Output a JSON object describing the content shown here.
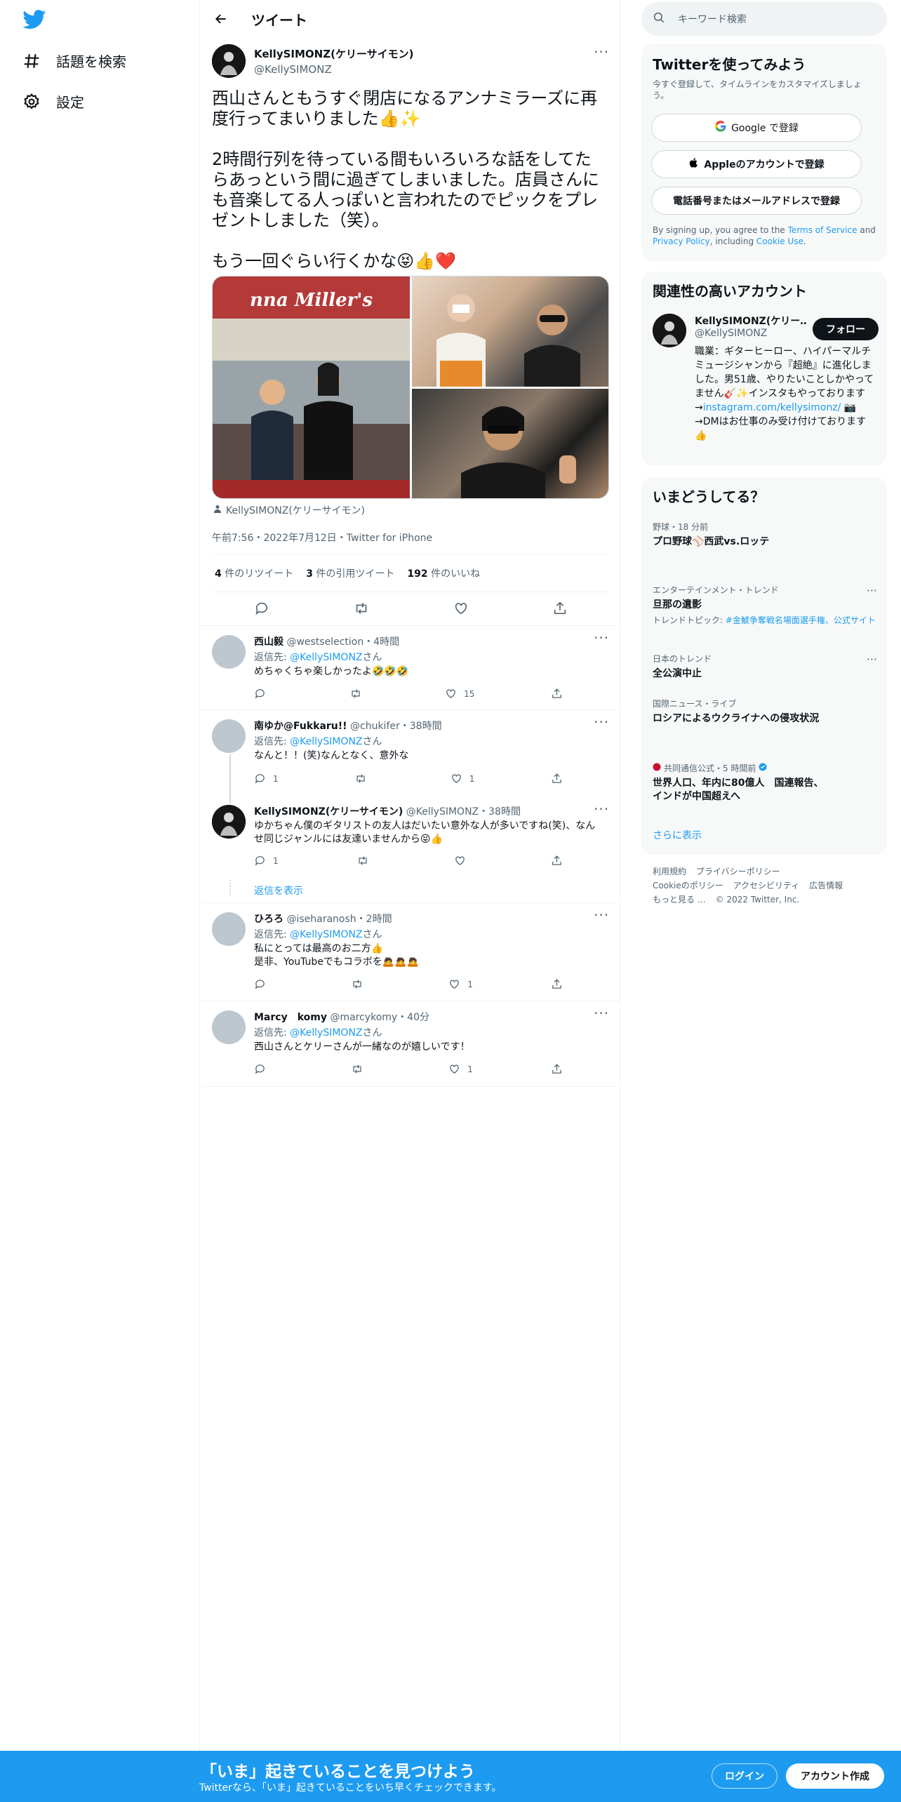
{
  "nav": {
    "explore_label": "話題を検索",
    "settings_label": "設定"
  },
  "header": {
    "title": "ツイート"
  },
  "tweet": {
    "author_name": "KellySIMONZ(ケリーサイモン)",
    "author_handle": "@KellySIMONZ",
    "text": "西山さんともうすぐ閉店になるアンナミラーズに再度行ってまいりました👍✨\n\n2時間行列を待っている間もいろいろな話をしてたらあっという間に過ぎてしまいました。店員さんにも音楽してる人っぽいと言われたのでピックをプレゼントしました（笑）。\n\nもう一回ぐらい行くかな😝👍❤️",
    "media_banner": "nna Miller's",
    "tagged": "KellySIMONZ(ケリーサイモン)",
    "meta": "午前7:56・2022年7月12日・Twitter for iPhone",
    "retweets": "4",
    "retweets_label": "件のリツイート",
    "quotes": "3",
    "quotes_label": "件の引用ツイート",
    "likes": "192",
    "likes_label": "件のいいね"
  },
  "replies": [
    {
      "name": "西山毅",
      "handle": "@westselection",
      "time": "・4時間",
      "reply_to_prefix": "返信先: ",
      "reply_to": "@KellySIMONZ",
      "reply_to_suffix": "さん",
      "text": "めちゃくちゃ楽しかったよ🤣🤣🤣",
      "reply_count": "",
      "retweet_count": "",
      "like_count": "15"
    },
    {
      "name": "南ゆか@Fukkaru!!",
      "handle": "@chukifer",
      "time": "・38時間",
      "reply_to_prefix": "返信先: ",
      "reply_to": "@KellySIMONZ",
      "reply_to_suffix": "さん",
      "text": "なんと！！(笑)なんとなく、意外な",
      "reply_count": "1",
      "retweet_count": "",
      "like_count": "1"
    },
    {
      "name": "KellySIMONZ(ケリーサイモン)",
      "handle": "@KellySIMONZ",
      "time": "・38時間",
      "text": "ゆかちゃん僕のギタリストの友人はだいたい意外な人が多いですね(笑)、なんせ同じジャンルには友達いませんから😝👍",
      "reply_count": "1",
      "retweet_count": "",
      "like_count": ""
    },
    {
      "name": "ひろろ",
      "handle": "@iseharanosh",
      "time": "・2時間",
      "reply_to_prefix": "返信先: ",
      "reply_to": "@KellySIMONZ",
      "reply_to_suffix": "さん",
      "text": "私にとっては最高のお二方👍\n是非、YouTubeでもコラボを🙇🙇🙇",
      "reply_count": "",
      "retweet_count": "",
      "like_count": "1"
    },
    {
      "name": "Marcy　komy",
      "handle": "@marcykomy",
      "time": "・40分",
      "reply_to_prefix": "返信先: ",
      "reply_to": "@KellySIMONZ",
      "reply_to_suffix": "さん",
      "text": "西山さんとケリーさんが一緒なのが嬉しいです！",
      "reply_count": "",
      "retweet_count": "",
      "like_count": "1"
    }
  ],
  "show_replies_label": "返信を表示",
  "search": {
    "placeholder": "キーワード検索"
  },
  "signup_panel": {
    "title": "Twitterを使ってみよう",
    "subtitle": "今すぐ登録して、タイムラインをカスタマイズしましょう。",
    "google_label": "Google で登録",
    "apple_label": "Appleのアカウントで登録",
    "phone_label": "電話番号またはメールアドレスで登録",
    "terms_prefix": "By signing up, you agree to the ",
    "terms_link": "Terms of Service",
    "terms_and": " and ",
    "privacy_link": "Privacy Policy",
    "terms_including": ", including ",
    "cookie_link": "Cookie Use",
    "terms_end": "."
  },
  "related_panel": {
    "title": "関連性の高いアカウント",
    "name": "KellySIMONZ(ケリー…",
    "handle": "@KellySIMONZ",
    "follow_label": "フォロー",
    "bio": "職業：ギターヒーロー、ハイパーマルチミュージシャンから『超絶』に進化しました。男51歳、やりたいことしかやってません🎸✨インスタもやっております\n→",
    "bio_link": "instagram.com/kellysimonz/",
    "bio_end": " 📷\n→DMはお仕事のみ受け付けております👍"
  },
  "trends_panel": {
    "title": "いまどうしてる？",
    "items": [
      {
        "category": "野球・18 分前",
        "title": "プロ野球⚾西武vs.ロッテ",
        "sub": ""
      },
      {
        "category": "エンターテインメント・トレンド",
        "title": "旦那の遺影",
        "sub_prefix": "トレンドトピック: ",
        "sub_link": "#金鯱争奪戦名場面選手権、公式サイト"
      },
      {
        "category": "日本のトレンド",
        "title": "全公演中止",
        "sub": ""
      },
      {
        "category": "国際ニュース・ライブ",
        "title": "ロシアによるウクライナへの侵攻状況",
        "sub": ""
      },
      {
        "category": "共同通信公式・5 時間前",
        "title": "世界人口、年内に80億人　国連報告、インドが中国超えへ",
        "sub": ""
      }
    ],
    "show_more": "さらに表示"
  },
  "footer": {
    "links": [
      "利用規約",
      "プライバシーポリシー",
      "Cookieのポリシー",
      "アクセシビリティ",
      "広告情報",
      "もっと見る …"
    ],
    "copyright": "© 2022 Twitter, Inc."
  },
  "bottom_bar": {
    "title": "「いま」起きていることを見つけよう",
    "subtitle": "Twitterなら、「いま」起きていることをいち早くチェックできます。",
    "login_label": "ログイン",
    "signup_label": "アカウント作成"
  },
  "colors": {
    "accent": "#1d9bf0",
    "text": "#0f1419",
    "muted": "#536471"
  }
}
